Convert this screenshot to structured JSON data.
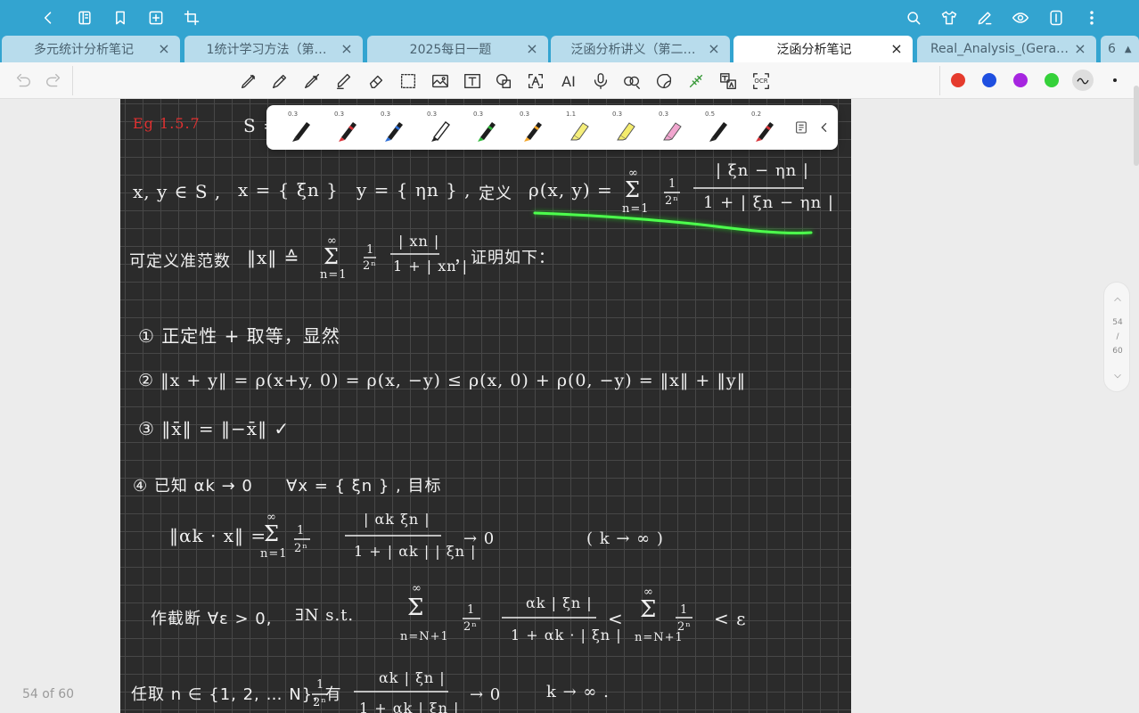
{
  "topbar": {
    "left_icons": [
      "back-icon",
      "outline-icon",
      "bookmark-icon",
      "add-page-icon",
      "crop-icon"
    ],
    "right_icons": [
      "search-icon",
      "shirt-icon",
      "pen-edit-icon",
      "eye-icon",
      "panel-icon",
      "more-icon"
    ]
  },
  "tabs": [
    {
      "label": "多元统计分析笔记",
      "active": false
    },
    {
      "label": "1统计学习方法（第…",
      "active": false
    },
    {
      "label": "2025每日一题",
      "active": false
    },
    {
      "label": "泛函分析讲义（第二…",
      "active": false
    },
    {
      "label": "泛函分析笔记",
      "active": true
    },
    {
      "label": "Real_Analysis_(Gera…",
      "active": false
    }
  ],
  "tab_count": "6",
  "toolbar": {
    "tools": [
      "pen-tool",
      "pencil-tool",
      "fountain-pen-tool",
      "highlighter-tool",
      "eraser-tool",
      "lasso-select-tool",
      "image-tool",
      "text-tool",
      "shape-tool",
      "text-recognition-tool",
      "ai-tool",
      "microphone-tool",
      "spell-tool",
      "sticker-tool",
      "laser-tool",
      "translate-tool",
      "ocr-tool"
    ],
    "ai_label": "AI",
    "ocr_label": "OCR",
    "colors": [
      "#e53b2d",
      "#1f4fe0",
      "#a625e0",
      "#35d13a"
    ]
  },
  "pen_popup": {
    "pens": [
      {
        "size": "0.3",
        "color": "#222222",
        "kind": "pen"
      },
      {
        "size": "0.3",
        "color": "#d8333a",
        "kind": "pen"
      },
      {
        "size": "0.3",
        "color": "#2d6fd8",
        "kind": "pen"
      },
      {
        "size": "0.3",
        "color": "#222222",
        "kind": "pen-outline"
      },
      {
        "size": "0.3",
        "color": "#2fb83a",
        "kind": "pen"
      },
      {
        "size": "0.3",
        "color": "#f3a62a",
        "kind": "pen"
      },
      {
        "size": "1.1",
        "color": "#f5ee7a",
        "kind": "highlighter"
      },
      {
        "size": "0.3",
        "color": "#f4ec6c",
        "kind": "highlighter"
      },
      {
        "size": "0.3",
        "color": "#f1a6cf",
        "kind": "highlighter"
      },
      {
        "size": "0.5",
        "color": "#222222",
        "kind": "pen"
      },
      {
        "size": "0.2",
        "color": "#d8333a",
        "kind": "pen"
      }
    ]
  },
  "notes": {
    "example_label": "Eg 1.5.7",
    "s_eq": "S =",
    "line1_a": "x, y ∈ S ,",
    "line1_b": "x = { ξn }",
    "line1_c": "y = { ηn } ,",
    "line1_d": "定义",
    "line1_rho": "ρ(x, y) =",
    "sum_top": "∞",
    "sum_sym": "Σ",
    "sum_bottom": "n=1",
    "frac_half_num": "1",
    "frac_half_den": "2ⁿ",
    "rho_num": "| ξn − ηn |",
    "rho_den": "1 + | ξn − ηn |",
    "line2_a": "可定义准范数",
    "line2_b": "‖x‖ ≙",
    "norm_num": "| xn |",
    "norm_den": "1 + | xn |",
    "line2_c": "，证明如下：",
    "item1": "① 正定性 + 取等，显然",
    "item2": "② ‖x + y‖ = ρ(x+y, 0) = ρ(x, −y) ≤ ρ(x, 0) + ρ(0, −y) = ‖x‖ + ‖y‖",
    "item3": "③ ‖x̄‖ = ‖−x̄‖ ✓",
    "item4_a": "④ 已知 αk → 0",
    "item4_b": "∀x = { ξn } , 目标",
    "item4_lhs": "‖αk · x‖ =",
    "item4_num": "| αk ξn |",
    "item4_den": "1 + | αk | | ξn |",
    "item4_lim": "→ 0",
    "item4_cond": "( k → ∞ )",
    "trunc_a": "作截断 ∀ε > 0,",
    "trunc_b": "∃N s.t.",
    "trunc_sum_bottom": "n=N+1",
    "trunc_num": "αk | ξn |",
    "trunc_den": "1 + αk · | ξn |",
    "trunc_lt": "<",
    "trunc_lt2": "< ε",
    "last_a": "任取 n ∈ {1, 2, … N}, 有",
    "last_num": "αk | ξn |",
    "last_den": "1 + αk | ξn |",
    "last_lim": "→ 0",
    "last_cond": "k → ∞ ."
  },
  "scroll": {
    "up_icon": "chevron-up-icon",
    "page": "54",
    "slash": "/",
    "total": "60",
    "down_icon": "chevron-down-icon"
  },
  "page_indicator": "54 of 60"
}
